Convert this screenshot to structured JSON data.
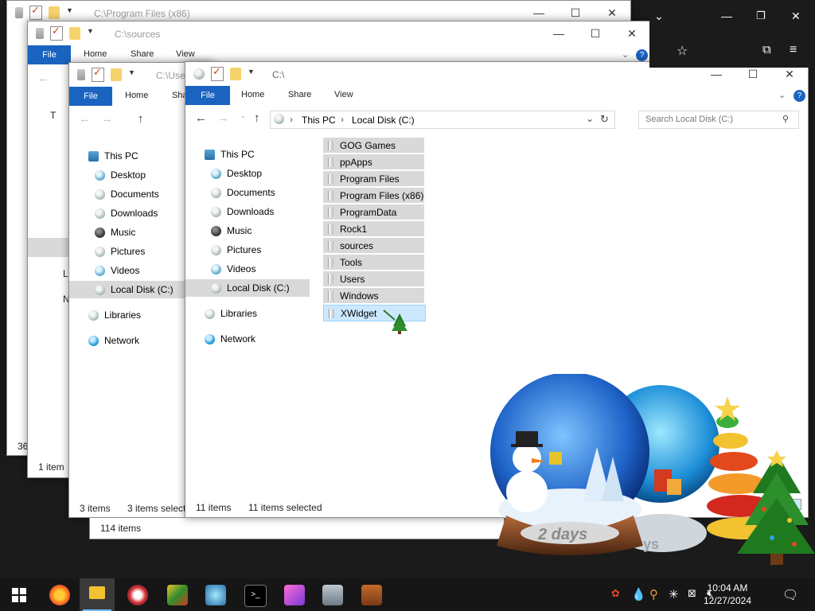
{
  "windows": {
    "back1": {
      "path": "C:\\Program Files (x86)",
      "status_count": "36",
      "status_small": "1 i"
    },
    "back2": {
      "path": "C:\\sources",
      "tabs": [
        "File",
        "Home",
        "Share",
        "View"
      ],
      "status": "1 item",
      "nav_partial": [
        "T",
        "L",
        "N"
      ]
    },
    "back3": {
      "path": "C:\\Use",
      "tabs": [
        "File",
        "Home",
        "Sha"
      ],
      "status_items": "3 items",
      "status_selected": "3 items selecte",
      "status_bottom": "114 items"
    },
    "front": {
      "path": "C:\\",
      "tabs": [
        "File",
        "Home",
        "Share",
        "View"
      ],
      "breadcrumb": [
        "This PC",
        "Local Disk (C:)"
      ],
      "search_placeholder": "Search Local Disk (C:)",
      "nav": [
        {
          "label": "This PC",
          "icon": "this-pc-icon"
        },
        {
          "label": "Desktop",
          "icon": "desktop-icon"
        },
        {
          "label": "Documents",
          "icon": "documents-icon"
        },
        {
          "label": "Downloads",
          "icon": "downloads-icon"
        },
        {
          "label": "Music",
          "icon": "music-icon"
        },
        {
          "label": "Pictures",
          "icon": "pictures-icon"
        },
        {
          "label": "Videos",
          "icon": "videos-icon"
        },
        {
          "label": "Local Disk (C:)",
          "icon": "drive-icon",
          "selected": true
        },
        {
          "label": "Libraries",
          "icon": "libraries-icon"
        },
        {
          "label": "Network",
          "icon": "network-icon"
        }
      ],
      "files": [
        "GOG Games",
        "ppApps",
        "Program Files",
        "Program Files (x86)",
        "ProgramData",
        "Rock1",
        "sources",
        "Tools",
        "Users",
        "Windows",
        "XWidget"
      ],
      "status_items": "11 items",
      "status_selected": "11 items selected"
    }
  },
  "widget": {
    "countdown_label": "2 days",
    "back_label": "ys"
  },
  "taskbar": {
    "clock_time": "10:04 AM",
    "clock_date": "12/27/2024",
    "apps": [
      "start-icon",
      "firefox-icon",
      "file-explorer-icon",
      "app-mascot-icon",
      "app-game-icon",
      "app-tools-icon",
      "terminal-icon",
      "app-pink-icon",
      "app-gallery-icon",
      "app-box-icon"
    ]
  },
  "colors": {
    "accent": "#1a64c0",
    "selection": "#cce8ff",
    "nav_selected": "#d9d9d9"
  }
}
